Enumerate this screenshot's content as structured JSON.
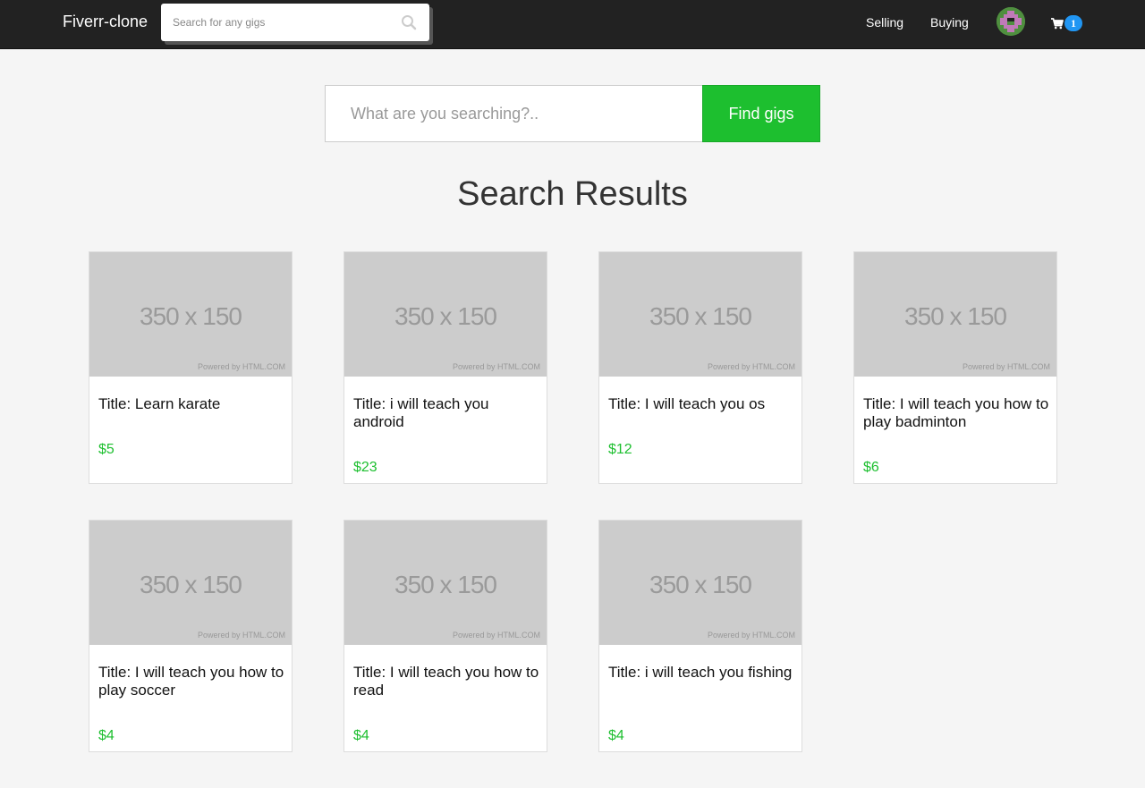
{
  "navbar": {
    "brand": "Fiverr-clone",
    "search_placeholder": "Search for any gigs",
    "links": {
      "selling": "Selling",
      "buying": "Buying"
    },
    "cart_count": "1"
  },
  "search": {
    "placeholder": "What are you searching?..",
    "button_label": "Find gigs"
  },
  "results_title": "Search Results",
  "placeholder_image": {
    "size_text": "350 x 150",
    "powered_text": "Powered by HTML.COM"
  },
  "gigs": [
    {
      "title": "Title: Learn karate",
      "price": "$5"
    },
    {
      "title": "Title: i will teach you android",
      "price": "$23"
    },
    {
      "title": "Title: I will teach you os",
      "price": "$12"
    },
    {
      "title": "Title: I will teach you how to play badminton",
      "price": "$6"
    },
    {
      "title": "Title: I will teach you how to play soccer",
      "price": "$4"
    },
    {
      "title": "Title: I will teach you how to read",
      "price": "$4"
    },
    {
      "title": "Title: i will teach you fishing",
      "price": "$4"
    }
  ],
  "colors": {
    "accent": "#1dbf2f",
    "navbar": "#222222",
    "badge": "#2196f3"
  }
}
